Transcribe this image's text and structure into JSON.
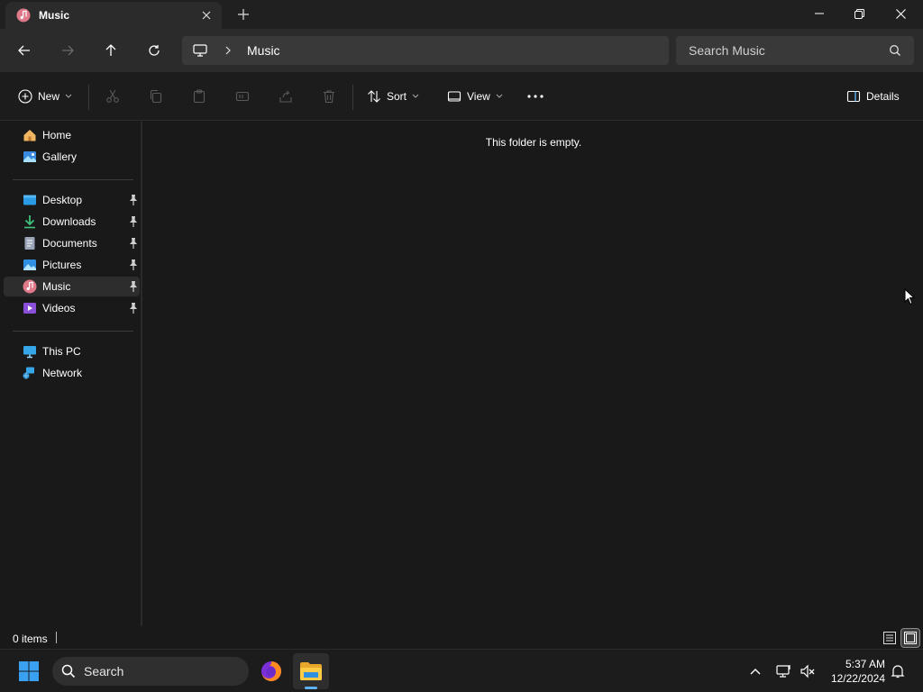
{
  "tab": {
    "title": "Music",
    "icon": "music-icon"
  },
  "window_controls": [
    "minimize-icon",
    "restore-icon",
    "close-icon"
  ],
  "address": {
    "segments": [
      "Music"
    ]
  },
  "search": {
    "placeholder": "Search Music"
  },
  "commands": {
    "new_label": "New",
    "sort_label": "Sort",
    "view_label": "View",
    "details_label": "Details"
  },
  "sidebar": {
    "quick": [
      {
        "label": "Home",
        "icon": "home-icon"
      },
      {
        "label": "Gallery",
        "icon": "gallery-icon"
      }
    ],
    "pinned": [
      {
        "label": "Desktop",
        "icon": "desktop-icon"
      },
      {
        "label": "Downloads",
        "icon": "downloads-icon"
      },
      {
        "label": "Documents",
        "icon": "documents-icon"
      },
      {
        "label": "Pictures",
        "icon": "pictures-icon"
      },
      {
        "label": "Music",
        "icon": "music-icon",
        "selected": true
      },
      {
        "label": "Videos",
        "icon": "videos-icon"
      }
    ],
    "devices": [
      {
        "label": "This PC",
        "icon": "this-pc-icon"
      },
      {
        "label": "Network",
        "icon": "network-icon"
      }
    ]
  },
  "main": {
    "empty_message": "This folder is empty."
  },
  "status": {
    "item_count": "0 items"
  },
  "taskbar": {
    "search_label": "Search",
    "time": "5:37 AM",
    "date": "12/22/2024"
  },
  "colors": {
    "accent": "#5fb2f2",
    "background": "#191919",
    "selected": "#2d2d2d"
  }
}
